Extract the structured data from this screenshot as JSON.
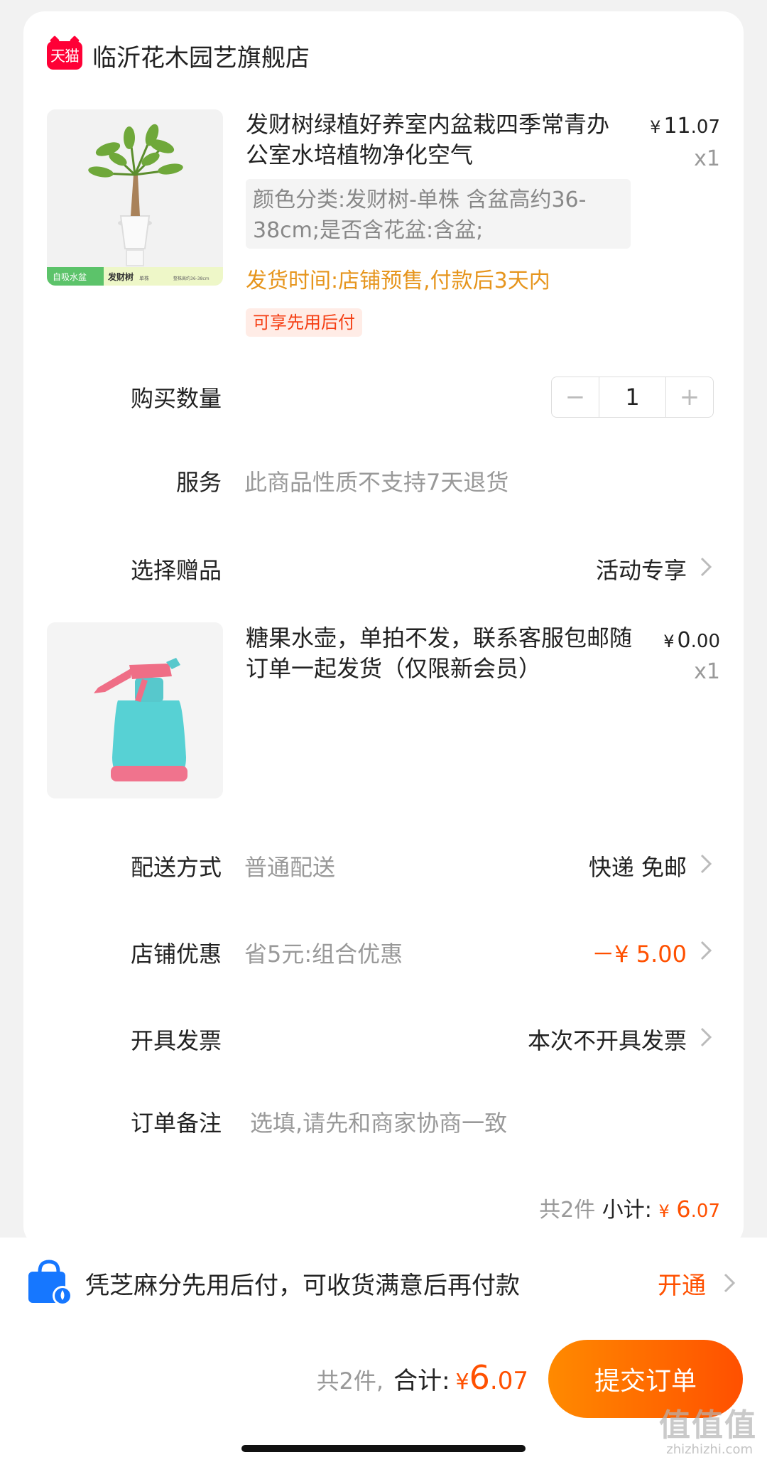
{
  "store": {
    "logo_text": "天猫",
    "name": "临沂花木园艺旗舰店"
  },
  "product": {
    "title": "发财树绿植好养室内盆栽四季常青办公室水培植物净化空气",
    "price_currency": "¥",
    "price_int": "11",
    "price_dec": ".07",
    "quantity_text": "x1",
    "sku": "颜色分类:发财树-单株 含盆高约36-38cm;是否含花盆:含盆;",
    "shipping": "发货时间:店铺预售,付款后3天内",
    "tag": "可享先用后付",
    "image_label_left": "自吸水盆",
    "image_label_mid": "发财树",
    "image_label_unit": "单株",
    "image_label_right": "整株高约36-38cm"
  },
  "quantity": {
    "label": "购买数量",
    "minus": "−",
    "value": "1",
    "plus": "+"
  },
  "service": {
    "label": "服务",
    "value": "此商品性质不支持7天退货"
  },
  "gift": {
    "label": "选择赠品",
    "value": "活动专享",
    "title": "糖果水壶，单拍不发，联系客服包邮随订单一起发货（仅限新会员）",
    "price_currency": "¥",
    "price_int": "0",
    "price_dec": ".00",
    "quantity_text": "x1"
  },
  "delivery": {
    "label": "配送方式",
    "sub": "普通配送",
    "value": "快递 免邮"
  },
  "discount": {
    "label": "店铺优惠",
    "sub": "省5元:组合优惠",
    "value": "－¥ 5.00"
  },
  "invoice": {
    "label": "开具发票",
    "value": "本次不开具发票"
  },
  "note": {
    "label": "订单备注",
    "placeholder": "选填,请先和商家协商一致"
  },
  "subtotal": {
    "count": "共2件",
    "label": "小计:",
    "currency": "¥",
    "int": "6",
    "dec": ".07"
  },
  "pay_later": {
    "text": "凭芝麻分先用后付，可收货满意后再付款",
    "action": "开通"
  },
  "footer": {
    "count": "共2件,",
    "label": "合计:",
    "currency": "¥",
    "int": "6",
    "dec": ".07",
    "submit": "提交订单",
    "watermark": "值值值",
    "watermark_sub": "zhizhizhi.com"
  },
  "colors": {
    "accent": "#ff5000",
    "shipping": "#e6951d",
    "tmall": "#ff0036"
  }
}
